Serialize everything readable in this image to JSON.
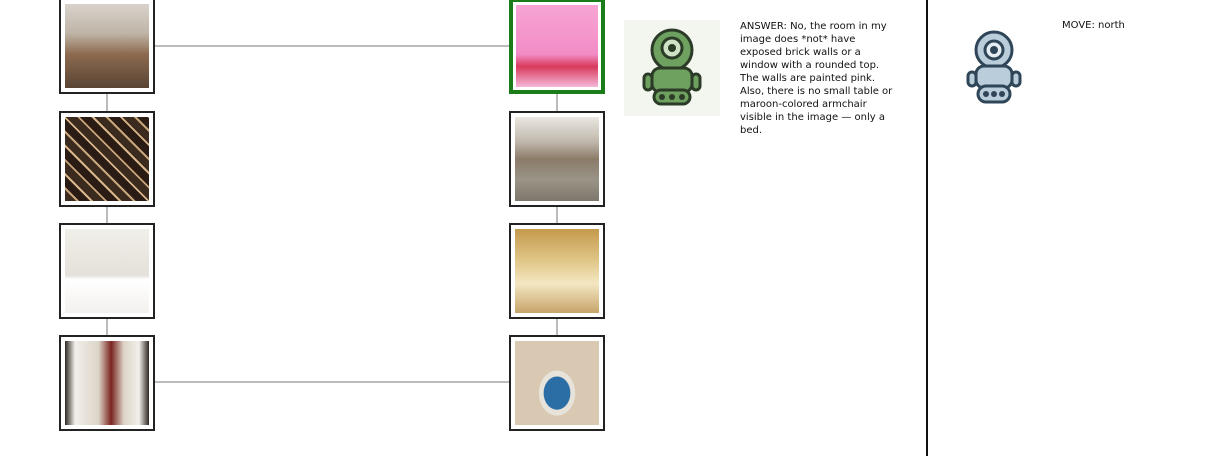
{
  "map": {
    "current_room": "pink-bedroom",
    "rooms": [
      {
        "id": "office",
        "icon": "office-photo"
      },
      {
        "id": "wine-cellar",
        "icon": "wine-cellar-photo"
      },
      {
        "id": "bedroom-twin",
        "icon": "bedroom-photo"
      },
      {
        "id": "hallway",
        "icon": "hallway-photo"
      },
      {
        "id": "pink-bedroom",
        "icon": "pink-bedroom-photo"
      },
      {
        "id": "brick-basement",
        "icon": "brick-basement-photo"
      },
      {
        "id": "bedroom-warm",
        "icon": "bedroom-photo"
      },
      {
        "id": "indoor-pool",
        "icon": "indoor-pool-photo"
      }
    ]
  },
  "answerer": {
    "icon": "green-robot-icon",
    "accent": "#5e8f52",
    "text": "ANSWER: No, the room in my image does *not* have exposed brick walls or a window with a rounded top. The walls are painted pink. Also, there is no small table or maroon-colored armchair visible in the image — only a bed."
  },
  "player": {
    "icon": "blue-robot-icon",
    "accent": "#5b7e99",
    "move_text": "MOVE: north"
  }
}
